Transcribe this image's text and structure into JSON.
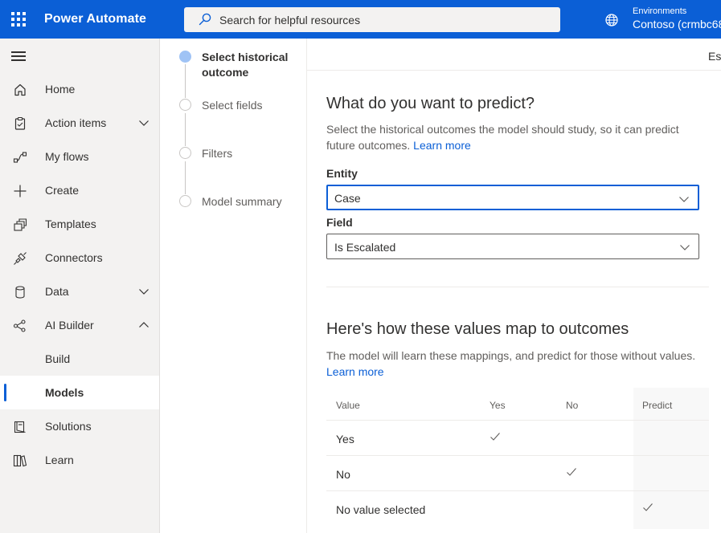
{
  "header": {
    "app_title": "Power Automate",
    "search_placeholder": "Search for helpful resources",
    "environment_label": "Environments",
    "environment_name": "Contoso (crmbc68"
  },
  "nav": {
    "items": [
      {
        "label": "Home",
        "icon": "home-icon"
      },
      {
        "label": "Action items",
        "icon": "clipboard-icon",
        "expandable": true
      },
      {
        "label": "My flows",
        "icon": "flow-icon"
      },
      {
        "label": "Create",
        "icon": "plus-icon"
      },
      {
        "label": "Templates",
        "icon": "templates-icon"
      },
      {
        "label": "Connectors",
        "icon": "connector-icon"
      },
      {
        "label": "Data",
        "icon": "database-icon",
        "expandable": true
      },
      {
        "label": "AI Builder",
        "icon": "ai-builder-icon",
        "expanded": true
      },
      {
        "label": "Build"
      },
      {
        "label": "Models",
        "selected": true
      },
      {
        "label": "Solutions",
        "icon": "solutions-icon"
      },
      {
        "label": "Learn",
        "icon": "book-icon"
      }
    ]
  },
  "steps": [
    {
      "label": "Select historical outcome",
      "active": true
    },
    {
      "label": "Select fields"
    },
    {
      "label": "Filters"
    },
    {
      "label": "Model summary"
    }
  ],
  "commandbar": {
    "partial_label": "Esl"
  },
  "predict_section": {
    "title": "What do you want to predict?",
    "description": "Select the historical outcomes the model should study, so it can predict future outcomes.",
    "learn_more": "Learn more",
    "entity_label": "Entity",
    "entity_value": "Case",
    "field_label": "Field",
    "field_value": "Is Escalated"
  },
  "mapping_section": {
    "title": "Here's how these values map to outcomes",
    "description": "The model will learn these mappings, and predict for those without values.",
    "learn_more": "Learn more",
    "columns": [
      "Value",
      "Yes",
      "No",
      "Predict"
    ],
    "rows": [
      {
        "value": "Yes",
        "mapping": "Yes"
      },
      {
        "value": "No",
        "mapping": "No"
      },
      {
        "value": "No value selected",
        "mapping": "Predict"
      }
    ]
  },
  "colors": {
    "brand": "#0b5fd6",
    "active_step": "#9fc3f5",
    "nav_bg": "#f3f2f1"
  }
}
